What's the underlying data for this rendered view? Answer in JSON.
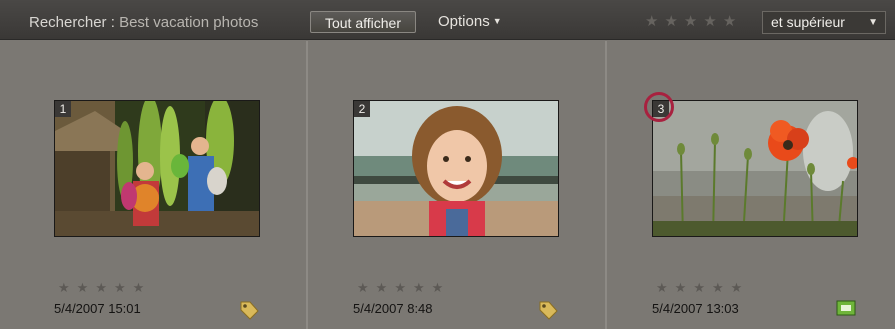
{
  "search": {
    "label": "Rechercher",
    "separator": " : ",
    "term": "Best vacation photos"
  },
  "toolbar": {
    "show_all_label": "Tout afficher",
    "options_label": "Options",
    "rating_filter_value": "et supérieur"
  },
  "photos": [
    {
      "number": "1",
      "date": "5/4/2007 15:01",
      "badge": "tag-icon",
      "rating": 0
    },
    {
      "number": "2",
      "date": "5/4/2007 8:48",
      "badge": "tag-icon",
      "rating": 0
    },
    {
      "number": "3",
      "date": "5/4/2007 13:03",
      "badge": "media-icon",
      "rating": 0
    }
  ],
  "colors": {
    "background": "#7b7873",
    "topbar": "#3f3d3b",
    "highlight_ring": "#a8213f"
  }
}
